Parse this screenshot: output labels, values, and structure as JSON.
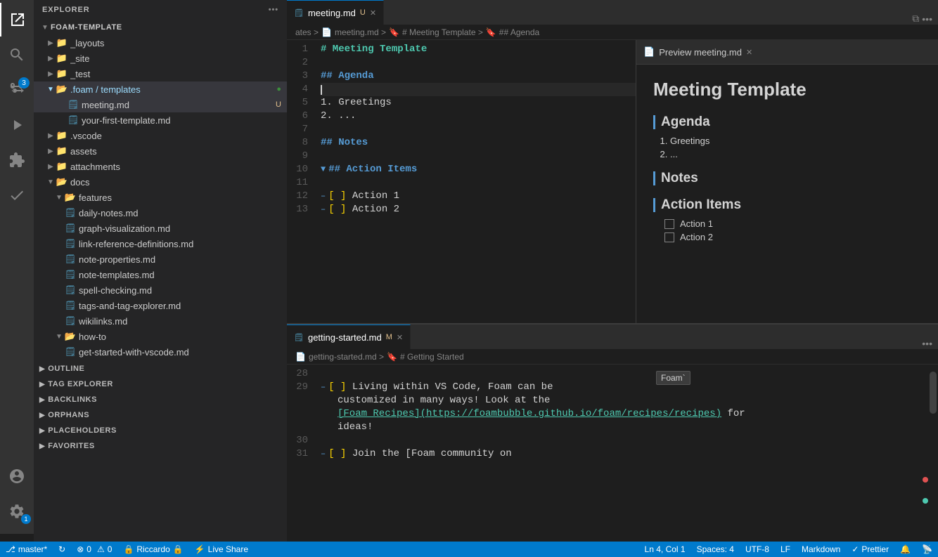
{
  "app": {
    "title": "EXPLORER"
  },
  "activity_bar": {
    "items": [
      {
        "name": "explorer-icon",
        "icon": "⊞",
        "active": true
      },
      {
        "name": "search-icon",
        "icon": "🔍",
        "active": false
      },
      {
        "name": "source-control-icon",
        "icon": "⑂",
        "active": false,
        "badge": "3"
      },
      {
        "name": "run-debug-icon",
        "icon": "▷",
        "active": false
      },
      {
        "name": "extensions-icon",
        "icon": "⧉",
        "active": false
      },
      {
        "name": "checklist-icon",
        "icon": "✓",
        "active": false
      }
    ],
    "bottom": [
      {
        "name": "account-icon",
        "icon": "👤"
      },
      {
        "name": "settings-icon",
        "icon": "⚙"
      }
    ]
  },
  "sidebar": {
    "header": "EXPLORER",
    "root": "FOAM-TEMPLATE",
    "tree": [
      {
        "id": "layouts",
        "label": "_layouts",
        "indent": 1,
        "type": "folder",
        "expanded": false
      },
      {
        "id": "site",
        "label": "_site",
        "indent": 1,
        "type": "folder",
        "expanded": false
      },
      {
        "id": "test",
        "label": "_test",
        "indent": 1,
        "type": "folder",
        "expanded": false
      },
      {
        "id": "foam-templates",
        "label": ".foam / templates",
        "indent": 1,
        "type": "folder-open",
        "expanded": true,
        "highlighted": true,
        "badge": "dot"
      },
      {
        "id": "meeting-md",
        "label": "meeting.md",
        "indent": 2,
        "type": "file-md",
        "badge": "U",
        "selected": true
      },
      {
        "id": "your-first-template-md",
        "label": "your-first-template.md",
        "indent": 2,
        "type": "file-md"
      },
      {
        "id": "vscode",
        "label": ".vscode",
        "indent": 1,
        "type": "folder",
        "expanded": false
      },
      {
        "id": "assets",
        "label": "assets",
        "indent": 1,
        "type": "folder",
        "expanded": false
      },
      {
        "id": "attachments",
        "label": "attachments",
        "indent": 1,
        "type": "folder",
        "expanded": false
      },
      {
        "id": "docs",
        "label": "docs",
        "indent": 1,
        "type": "folder",
        "expanded": true
      },
      {
        "id": "features",
        "label": "features",
        "indent": 2,
        "type": "folder",
        "expanded": true
      },
      {
        "id": "daily-notes-md",
        "label": "daily-notes.md",
        "indent": 3,
        "type": "file-md"
      },
      {
        "id": "graph-visualization-md",
        "label": "graph-visualization.md",
        "indent": 3,
        "type": "file-md"
      },
      {
        "id": "link-reference-definitions-md",
        "label": "link-reference-definitions.md",
        "indent": 3,
        "type": "file-md"
      },
      {
        "id": "note-properties-md",
        "label": "note-properties.md",
        "indent": 3,
        "type": "file-md"
      },
      {
        "id": "note-templates-md",
        "label": "note-templates.md",
        "indent": 3,
        "type": "file-md"
      },
      {
        "id": "spell-checking-md",
        "label": "spell-checking.md",
        "indent": 3,
        "type": "file-md"
      },
      {
        "id": "tags-and-tag-explorer-md",
        "label": "tags-and-tag-explorer.md",
        "indent": 3,
        "type": "file-md"
      },
      {
        "id": "wikilinks-md",
        "label": "wikilinks.md",
        "indent": 3,
        "type": "file-md"
      },
      {
        "id": "how-to",
        "label": "how-to",
        "indent": 2,
        "type": "folder",
        "expanded": true
      },
      {
        "id": "get-started-with-vscode-md",
        "label": "get-started-with-vscode.md",
        "indent": 3,
        "type": "file-md"
      }
    ],
    "sections": [
      {
        "id": "outline",
        "label": "OUTLINE"
      },
      {
        "id": "tag-explorer",
        "label": "TAG EXPLORER"
      },
      {
        "id": "backlinks",
        "label": "BACKLINKS"
      },
      {
        "id": "orphans",
        "label": "ORPHANS"
      },
      {
        "id": "placeholders",
        "label": "PLACEHOLDERS"
      },
      {
        "id": "favorites",
        "label": "FAVORITES"
      }
    ]
  },
  "tabs": {
    "top": [
      {
        "id": "meeting-md",
        "label": "meeting.md",
        "modified": "U",
        "active": true
      },
      {
        "id": "preview-meeting-md",
        "label": "Preview meeting.md",
        "active": false
      }
    ],
    "bottom": [
      {
        "id": "getting-started-md",
        "label": "getting-started.md",
        "modified": "M",
        "active": true
      }
    ]
  },
  "breadcrumbs": {
    "top": [
      "ates >",
      "meeting.md >",
      "# Meeting Template >",
      "## Agenda"
    ],
    "bottom": [
      "getting-started.md >",
      "# Getting Started"
    ]
  },
  "editor_top": {
    "lines": [
      {
        "num": 1,
        "tokens": [
          {
            "t": "# Meeting Template",
            "c": "h1"
          }
        ]
      },
      {
        "num": 2,
        "tokens": []
      },
      {
        "num": 3,
        "tokens": [
          {
            "t": "## Agenda",
            "c": "heading"
          }
        ]
      },
      {
        "num": 4,
        "tokens": [],
        "cursor": true
      },
      {
        "num": 5,
        "tokens": [
          {
            "t": "1. Greetings",
            "c": "text"
          }
        ]
      },
      {
        "num": 6,
        "tokens": [
          {
            "t": "2. ...",
            "c": "text"
          }
        ]
      },
      {
        "num": 7,
        "tokens": []
      },
      {
        "num": 8,
        "tokens": [
          {
            "t": "## Notes",
            "c": "heading"
          }
        ]
      },
      {
        "num": 9,
        "tokens": []
      },
      {
        "num": 10,
        "tokens": [
          {
            "t": "## Action Items",
            "c": "heading"
          }
        ]
      },
      {
        "num": 11,
        "tokens": []
      },
      {
        "num": 12,
        "tokens": [
          {
            "t": "- [ ] Action 1",
            "c": "text"
          }
        ]
      },
      {
        "num": 13,
        "tokens": [
          {
            "t": "- [ ] Action 2",
            "c": "text"
          }
        ]
      }
    ]
  },
  "editor_bottom": {
    "lines": [
      {
        "num": 28,
        "tokens": []
      },
      {
        "num": 29,
        "tokens": [
          {
            "t": "- [ ] Living within VS Code, Foam can be",
            "c": "text"
          },
          {
            "t": "customized in many ways! Look at the",
            "c": "text"
          },
          {
            "t": "[Foam Recipes](https://foambubble.github.io/foam/recipes/recipes)",
            "c": "link"
          },
          {
            "t": " for",
            "c": "text"
          },
          {
            "t": "ideas!",
            "c": "text"
          }
        ]
      },
      {
        "num": 30,
        "tokens": []
      },
      {
        "num": 31,
        "tokens": [
          {
            "t": "- [ ] Join the [Foam community on",
            "c": "text"
          }
        ]
      }
    ]
  },
  "preview": {
    "title": "Meeting Template",
    "sections": [
      {
        "heading": "Agenda",
        "items": [
          "1. Greetings",
          "2. ..."
        ],
        "type": "ol"
      },
      {
        "heading": "Notes",
        "items": [],
        "type": "none"
      },
      {
        "heading": "Action Items",
        "items": [
          "Action 1",
          "Action 2"
        ],
        "type": "checkbox"
      }
    ]
  },
  "status_bar": {
    "left": [
      {
        "id": "branch",
        "text": "⎇ master*"
      },
      {
        "id": "sync",
        "text": "↻"
      },
      {
        "id": "errors",
        "text": "⊗ 0  ⚠ 0"
      },
      {
        "id": "user",
        "text": "Riccardo 🔒"
      },
      {
        "id": "live-share",
        "text": "⚡ Live Share"
      }
    ],
    "right": [
      {
        "id": "position",
        "text": "Ln 4, Col 1"
      },
      {
        "id": "spaces",
        "text": "Spaces: 4"
      },
      {
        "id": "encoding",
        "text": "UTF-8"
      },
      {
        "id": "eol",
        "text": "LF"
      },
      {
        "id": "language",
        "text": "Markdown"
      },
      {
        "id": "prettier",
        "text": "✓ Prettier"
      },
      {
        "id": "notif",
        "text": "🔔"
      },
      {
        "id": "broadcast",
        "text": "📡"
      }
    ]
  },
  "tooltip": {
    "text": "Foam`"
  }
}
